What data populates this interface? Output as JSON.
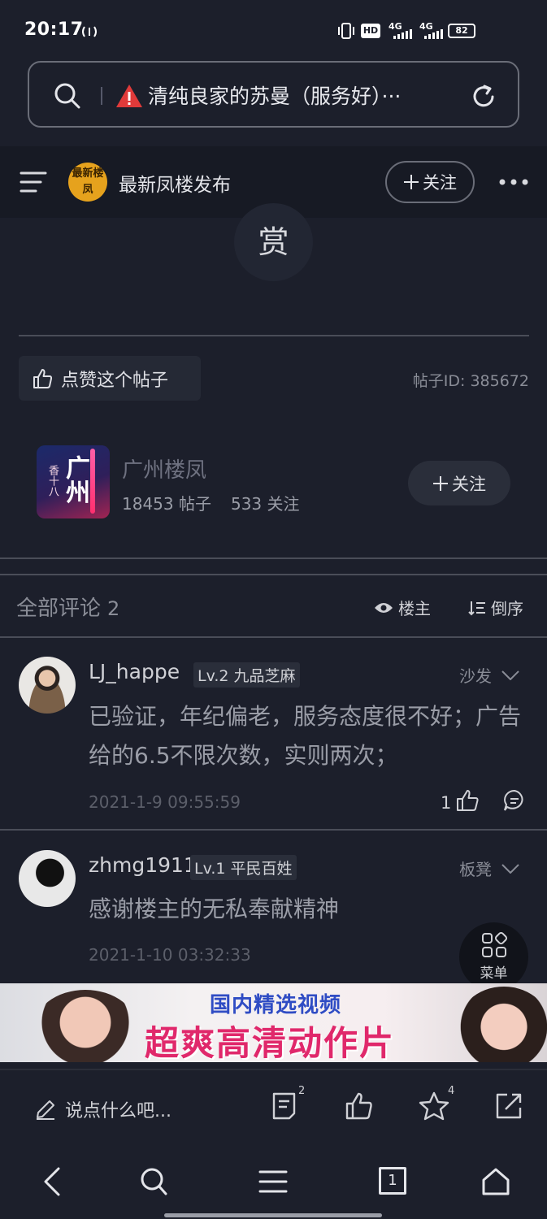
{
  "status_bar": {
    "time": "20:17",
    "hd": "HD",
    "net1": "4G",
    "net2": "4G",
    "battery": "82"
  },
  "url_bar": {
    "title": "清纯良家的苏曼（服务好）···"
  },
  "forum_header": {
    "logo_text": "最新楼凤",
    "name": "最新凤楼发布",
    "follow_label": "关注"
  },
  "reward": {
    "label": "赏"
  },
  "post": {
    "like_label": "点赞这个帖子",
    "post_id": "帖子ID: 385672"
  },
  "group": {
    "avatar_text": "广州",
    "avatar_sub": "香十八",
    "name": "广州楼凤",
    "posts": "18453 帖子",
    "follows": "533 关注",
    "follow_label": "关注"
  },
  "comments_header": {
    "title": "全部评论",
    "count": "2",
    "owner_label": "楼主",
    "order_label": "倒序"
  },
  "comments": [
    {
      "user": "LJ_happe",
      "level": "Lv.2 九品芝麻",
      "floor": "沙发",
      "text": "已验证，年纪偏老，服务态度很不好；广告给的6.5不限次数，实则两次；",
      "time": "2021-1-9 09:55:59",
      "likes": "1"
    },
    {
      "user": "zhmg1911",
      "level": "Lv.1 平民百姓",
      "floor": "板凳",
      "text": "感谢楼主的无私奉献精神",
      "time": "2021-1-10 03:32:33"
    }
  ],
  "fab": {
    "label": "菜单"
  },
  "ad": {
    "line1": "国内精选视频",
    "line2": "超爽高清动作片"
  },
  "action_bar": {
    "reply_placeholder": "说点什么吧...",
    "comment_badge": "2",
    "star_badge": "4"
  },
  "nav_bar": {
    "tabs_count": "1"
  }
}
